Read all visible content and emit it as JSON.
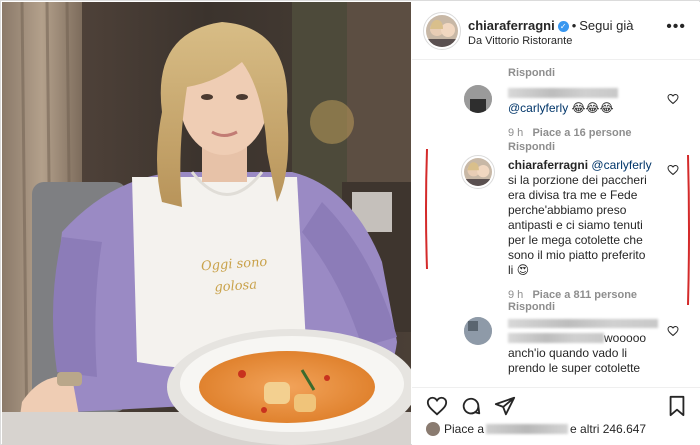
{
  "post": {
    "username": "chiaraferragni",
    "follow_label": "Segui già",
    "location": "Da Vittorio Ristorante",
    "bib_text_line1": "Oggi sono",
    "bib_text_line2": "golosa"
  },
  "comments": [
    {
      "reply_label": "Rispondi"
    },
    {
      "username": "",
      "mention": "@carlyferly",
      "text": " 😂😂😂",
      "time": "9 h",
      "likes": "Piace a 16 persone",
      "reply_label": "Rispondi"
    },
    {
      "username": "chiaraferragni",
      "mention": "@carlyferly",
      "text_lines": [
        "si la porzione dei paccheri",
        "era divisa tra me e Fede",
        "perche'abbiamo preso",
        "antipasti e ci siamo tenuti",
        "per le mega cotolette che",
        "sono il mio piatto preferito",
        "li 😍"
      ],
      "time": "9 h",
      "likes": "Piace a 811 persone",
      "reply_label": "Rispondi"
    },
    {
      "username": "",
      "text_inline": "wooooo",
      "text_lines": [
        "anch'io quando vado li",
        "prendo le super cotolette"
      ]
    }
  ],
  "likes_bar": {
    "prefix": "Piace a",
    "suffix": "e altri 246.647"
  },
  "colors": {
    "verified": "#3897f0",
    "annotation_red": "#d42a2a",
    "meta_gray": "#8e8e8e"
  },
  "icons": [
    "more-icon",
    "heart-icon",
    "comment-icon",
    "share-icon",
    "bookmark-icon",
    "verified-badge-icon"
  ]
}
